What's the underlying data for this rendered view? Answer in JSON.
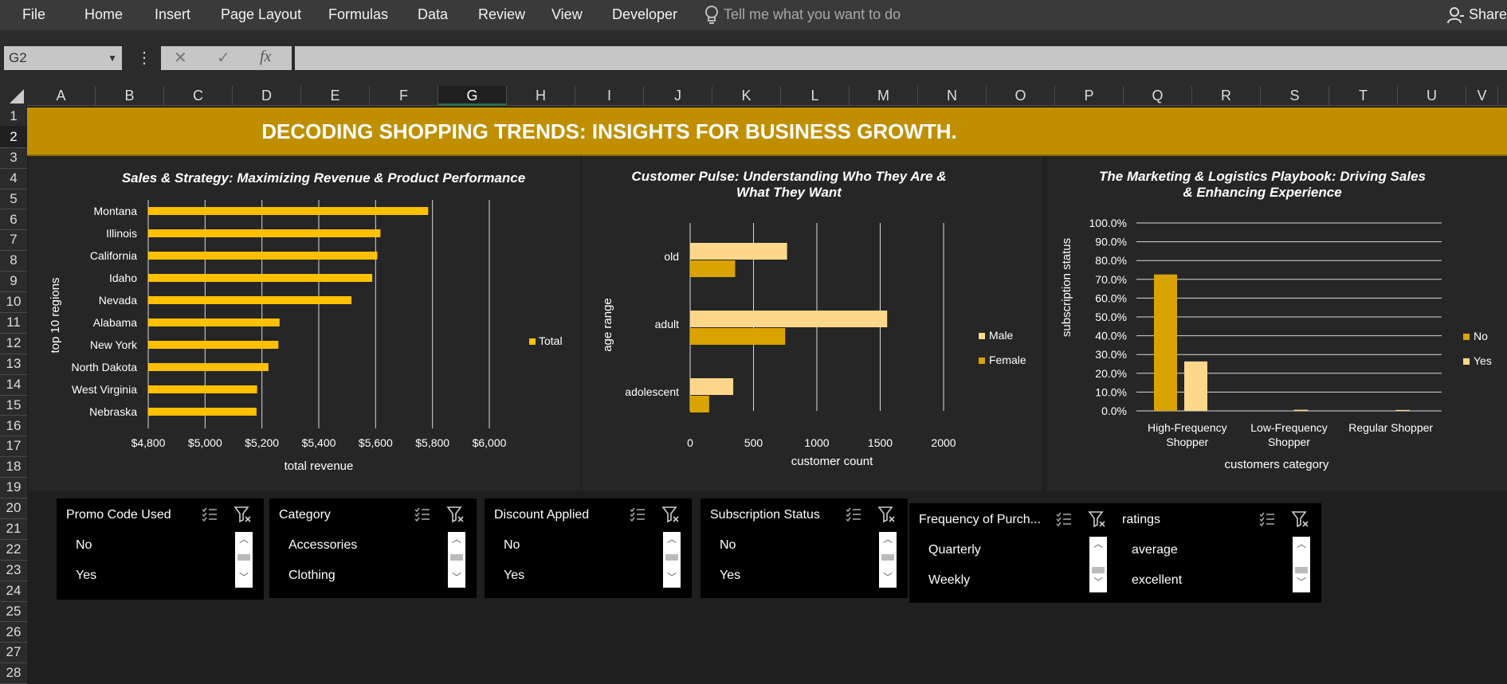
{
  "ribbon": {
    "tabs": [
      "File",
      "Home",
      "Insert",
      "Page Layout",
      "Formulas",
      "Data",
      "Review",
      "View",
      "Developer"
    ],
    "tell_me": "Tell me what you want to do",
    "share": "Share"
  },
  "formula_bar": {
    "name_box": "G2",
    "formula": ""
  },
  "columns": [
    "A",
    "B",
    "C",
    "D",
    "E",
    "F",
    "G",
    "H",
    "I",
    "J",
    "K",
    "L",
    "M",
    "N",
    "O",
    "P",
    "Q",
    "R",
    "S",
    "T",
    "U",
    "V"
  ],
  "rows": [
    "1",
    "2",
    "3",
    "4",
    "5",
    "6",
    "7",
    "8",
    "9",
    "10",
    "11",
    "12",
    "13",
    "14",
    "15",
    "16",
    "17",
    "18",
    "19",
    "20",
    "21",
    "22",
    "23",
    "24",
    "25",
    "26",
    "27",
    "28"
  ],
  "selected_cell": {
    "column": "G",
    "row": "2"
  },
  "dashboard_title": "DECODING SHOPPING TRENDS: INSIGHTS FOR BUSINESS GROWTH.",
  "colors": {
    "banner": "#bf8f00",
    "bar_gold": "#ffc000",
    "bar_dark_gold": "#d9a300",
    "bar_light": "#ffd78a"
  },
  "chart_data": [
    {
      "type": "bar",
      "orientation": "horizontal",
      "title": "Sales & Strategy: Maximizing Revenue & Product Performance",
      "xlabel": "total revenue",
      "ylabel": "top 10 regions",
      "categories": [
        "Montana",
        "Illinois",
        "California",
        "Idaho",
        "Nevada",
        "Alabama",
        "New York",
        "North Dakota",
        "West Virginia",
        "Nebraska"
      ],
      "series": [
        {
          "name": "Total",
          "values": [
            5785,
            5617,
            5606,
            5588,
            5515,
            5262,
            5258,
            5223,
            5183,
            5181
          ]
        }
      ],
      "xlim": [
        4800,
        6000
      ],
      "ticks": [
        "$4,800",
        "$5,000",
        "$5,200",
        "$5,400",
        "$5,600",
        "$5,800",
        "$6,000"
      ],
      "legend_position": "right"
    },
    {
      "type": "bar",
      "orientation": "horizontal",
      "title": "Customer Pulse: Understanding Who They Are & What They Want",
      "xlabel": "customer count",
      "ylabel": "age range",
      "categories": [
        "old",
        "adult",
        "adolescent"
      ],
      "series": [
        {
          "name": "Male",
          "values": [
            765,
            1555,
            340
          ]
        },
        {
          "name": "Female",
          "values": [
            355,
            750,
            150
          ]
        }
      ],
      "xlim": [
        0,
        2000
      ],
      "ticks": [
        "0",
        "500",
        "1000",
        "1500",
        "2000"
      ],
      "legend_position": "right"
    },
    {
      "type": "bar",
      "orientation": "vertical",
      "title": "The Marketing & Logistics Playbook: Driving Sales & Enhancing Experience",
      "xlabel": "customers category",
      "ylabel": "subscription status",
      "categories": [
        "High-Frequency Shopper",
        "Low-Frequency Shopper",
        "Regular Shopper"
      ],
      "series": [
        {
          "name": "No",
          "values": [
            72.6,
            0,
            0
          ]
        },
        {
          "name": "Yes",
          "values": [
            26.3,
            0.6,
            0.5
          ]
        }
      ],
      "ylim": [
        0,
        100
      ],
      "ticks": [
        "0.0%",
        "10.0%",
        "20.0%",
        "30.0%",
        "40.0%",
        "50.0%",
        "60.0%",
        "70.0%",
        "80.0%",
        "90.0%",
        "100.0%"
      ],
      "legend_position": "right"
    }
  ],
  "slicers": [
    {
      "title": "Promo Code Used",
      "items": [
        "No",
        "Yes"
      ]
    },
    {
      "title": "Category",
      "items": [
        "Accessories",
        "Clothing"
      ]
    },
    {
      "title": "Discount Applied",
      "items": [
        "No",
        "Yes"
      ]
    },
    {
      "title": "Subscription Status",
      "items": [
        "No",
        "Yes"
      ]
    },
    {
      "title": "Frequency of Purch...",
      "items": [
        "Quarterly",
        "Weekly"
      ]
    },
    {
      "title": "ratings",
      "items": [
        "average",
        "excellent"
      ]
    }
  ]
}
